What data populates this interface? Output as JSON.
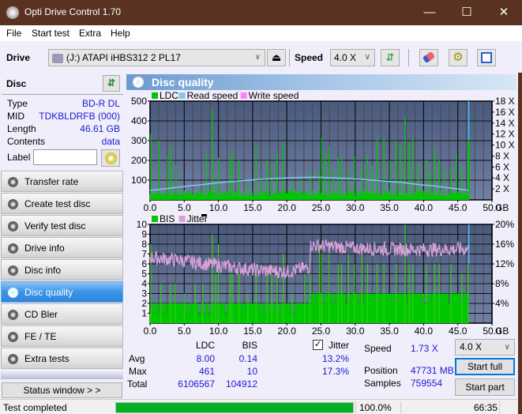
{
  "window": {
    "title": "Opti Drive Control 1.70",
    "minimize": "—",
    "maximize": "☐",
    "close": "✕"
  },
  "menu": [
    "File",
    "Start test",
    "Extra",
    "Help"
  ],
  "toolbar": {
    "drive_label": "Drive",
    "drive_value": "(J:)  ATAPI iHBS312   2 PL17",
    "speed_label": "Speed",
    "speed_value": "4.0 X",
    "icons": [
      "drive-icon",
      "eject-icon",
      "refresh-icon",
      "eraser-icon",
      "settings-icon",
      "save-icon"
    ]
  },
  "disc": {
    "header": "Disc",
    "rows": [
      {
        "key": "Type",
        "value": "BD-R DL"
      },
      {
        "key": "MID",
        "value": "TDKBLDRFB (000)"
      },
      {
        "key": "Length",
        "value": "46.61 GB"
      },
      {
        "key": "Contents",
        "value": "data"
      }
    ],
    "label_key": "Label",
    "label_value": ""
  },
  "nav": [
    {
      "label": "Transfer rate",
      "active": false
    },
    {
      "label": "Create test disc",
      "active": false
    },
    {
      "label": "Verify test disc",
      "active": false
    },
    {
      "label": "Drive info",
      "active": false
    },
    {
      "label": "Disc info",
      "active": false
    },
    {
      "label": "Disc quality",
      "active": true
    },
    {
      "label": "CD Bler",
      "active": false
    },
    {
      "label": "FE / TE",
      "active": false
    },
    {
      "label": "Extra tests",
      "active": false
    }
  ],
  "status_window_label": "Status window > >",
  "panel_title": "Disc quality",
  "colors": {
    "plot_bg_top": "#4a5a7e",
    "plot_bg_bottom": "#7080a4",
    "grid": "#1a1a1a",
    "ldc": "#00c800",
    "read_speed": "#80c8f0",
    "write_speed": "#ff80ff",
    "bis": "#00c800",
    "jitter": "#d8a0d8",
    "end_marker": "#40c0ff"
  },
  "chart_data": [
    {
      "type": "bar",
      "title": "LDC / Read speed",
      "legend": [
        "LDC",
        "Read speed",
        "Write speed"
      ],
      "legend_position": "top-left",
      "xlabel": "GB",
      "x_ticks": [
        "0.0",
        "5.0",
        "10.0",
        "15.0",
        "20.0",
        "25.0",
        "30.0",
        "35.0",
        "40.0",
        "45.0",
        "50.0"
      ],
      "xlim": [
        0,
        50
      ],
      "y_left_ticks": [
        "100",
        "200",
        "300",
        "400",
        "500"
      ],
      "ylim_left": [
        0,
        500
      ],
      "y_right_ticks": [
        "2 X",
        "4 X",
        "6 X",
        "8 X",
        "10 X",
        "12 X",
        "14 X",
        "16 X",
        "18 X"
      ],
      "ylim_right": [
        0,
        18
      ],
      "grid": true,
      "data_end_gb": 46.61,
      "ldc_peaks": [
        [
          0.1,
          335
        ],
        [
          1.3,
          300
        ],
        [
          2.6,
          220
        ],
        [
          3.0,
          270
        ],
        [
          3.8,
          175
        ],
        [
          4.5,
          60
        ],
        [
          5.7,
          50
        ],
        [
          7.4,
          60
        ],
        [
          8.2,
          230
        ],
        [
          9.1,
          461
        ],
        [
          9.6,
          90
        ],
        [
          10.0,
          215
        ],
        [
          11.7,
          210
        ],
        [
          12.0,
          255
        ],
        [
          13.0,
          205
        ],
        [
          14.3,
          95
        ],
        [
          15.5,
          275
        ],
        [
          16.3,
          100
        ],
        [
          17.1,
          200
        ],
        [
          17.8,
          175
        ],
        [
          18.6,
          235
        ],
        [
          19.5,
          295
        ],
        [
          20.8,
          95
        ],
        [
          22.0,
          100
        ],
        [
          23.4,
          140
        ],
        [
          24.8,
          150
        ],
        [
          25.1,
          315
        ],
        [
          25.6,
          230
        ],
        [
          26.2,
          270
        ],
        [
          26.8,
          150
        ],
        [
          27.5,
          210
        ],
        [
          28.0,
          225
        ],
        [
          29.0,
          165
        ],
        [
          29.9,
          220
        ],
        [
          31.0,
          165
        ],
        [
          31.8,
          225
        ],
        [
          32.5,
          175
        ],
        [
          33.2,
          310
        ],
        [
          34.2,
          310
        ],
        [
          35.1,
          200
        ],
        [
          36.0,
          300
        ],
        [
          36.6,
          275
        ],
        [
          37.3,
          420
        ],
        [
          37.9,
          290
        ],
        [
          38.4,
          310
        ],
        [
          39.2,
          190
        ],
        [
          40.4,
          205
        ],
        [
          41.0,
          140
        ],
        [
          41.6,
          260
        ],
        [
          42.3,
          205
        ],
        [
          43.0,
          160
        ],
        [
          44.0,
          165
        ],
        [
          44.8,
          235
        ],
        [
          45.6,
          175
        ],
        [
          46.5,
          290
        ]
      ],
      "read_speed_steps": [
        [
          0,
          1.73
        ],
        [
          1,
          1.85
        ],
        [
          2,
          2.0
        ],
        [
          3,
          2.15
        ],
        [
          4,
          2.3
        ],
        [
          5,
          2.45
        ],
        [
          6,
          2.6
        ],
        [
          7,
          2.7
        ],
        [
          8,
          2.85
        ],
        [
          9,
          3.0
        ],
        [
          10,
          3.15
        ],
        [
          11,
          3.25
        ],
        [
          12,
          3.35
        ],
        [
          13,
          3.45
        ],
        [
          14,
          3.55
        ],
        [
          15,
          3.65
        ],
        [
          16,
          3.75
        ],
        [
          17,
          3.8
        ],
        [
          18,
          3.9
        ],
        [
          19,
          3.95
        ],
        [
          20,
          4.0
        ],
        [
          21,
          4.05
        ],
        [
          22,
          4.1
        ],
        [
          23,
          4.1
        ],
        [
          24,
          4.15
        ],
        [
          25,
          4.1
        ],
        [
          26,
          4.05
        ],
        [
          27,
          4.0
        ],
        [
          28,
          3.95
        ],
        [
          29,
          3.9
        ],
        [
          30,
          3.8
        ],
        [
          31,
          3.75
        ],
        [
          32,
          3.65
        ],
        [
          33,
          3.55
        ],
        [
          34,
          3.45
        ],
        [
          35,
          3.35
        ],
        [
          36,
          3.25
        ],
        [
          37,
          3.15
        ],
        [
          38,
          3.0
        ],
        [
          39,
          2.85
        ],
        [
          40,
          2.7
        ],
        [
          41,
          2.6
        ],
        [
          42,
          2.45
        ],
        [
          43,
          2.3
        ],
        [
          44,
          2.15
        ],
        [
          45,
          2.0
        ],
        [
          46,
          1.85
        ],
        [
          46.61,
          1.73
        ]
      ]
    },
    {
      "type": "bar",
      "title": "BIS / Jitter",
      "legend": [
        "BIS",
        "Jitter"
      ],
      "legend_position": "top-left",
      "xlabel": "GB",
      "x_ticks": [
        "0.0",
        "5.0",
        "10.0",
        "15.0",
        "20.0",
        "25.0",
        "30.0",
        "35.0",
        "40.0",
        "45.0",
        "50.0"
      ],
      "xlim": [
        0,
        50
      ],
      "y_left_ticks": [
        "1",
        "2",
        "3",
        "4",
        "5",
        "6",
        "7",
        "8",
        "9",
        "10"
      ],
      "ylim_left": [
        0,
        10
      ],
      "y_right_ticks": [
        "4%",
        "8%",
        "12%",
        "16%",
        "20%"
      ],
      "ylim_right": [
        0,
        20
      ],
      "grid": true,
      "data_end_gb": 46.61,
      "bis_base_levels": [
        [
          0,
          23.3,
          2
        ],
        [
          23.3,
          46.61,
          3
        ]
      ],
      "bis_peaks": [
        [
          0.1,
          8
        ],
        [
          1.6,
          4
        ],
        [
          3.0,
          4
        ],
        [
          3.7,
          4
        ],
        [
          5.0,
          3
        ],
        [
          6.6,
          4
        ],
        [
          7.7,
          4
        ],
        [
          9.1,
          9
        ],
        [
          9.6,
          5
        ],
        [
          10.0,
          8
        ],
        [
          11.7,
          5
        ],
        [
          12.0,
          5
        ],
        [
          13.0,
          5
        ],
        [
          14.3,
          3
        ],
        [
          15.5,
          5
        ],
        [
          17.1,
          5
        ],
        [
          17.8,
          5
        ],
        [
          18.6,
          5
        ],
        [
          19.5,
          7
        ],
        [
          20.8,
          3
        ],
        [
          22.6,
          5
        ],
        [
          23.4,
          5
        ],
        [
          24.8,
          8
        ],
        [
          25.1,
          7
        ],
        [
          26.2,
          7
        ],
        [
          27.5,
          6
        ],
        [
          28.0,
          6
        ],
        [
          29.0,
          7
        ],
        [
          29.9,
          6
        ],
        [
          31.0,
          7
        ],
        [
          31.8,
          6
        ],
        [
          33.2,
          6
        ],
        [
          34.2,
          6
        ],
        [
          36.0,
          6
        ],
        [
          37.3,
          10
        ],
        [
          37.9,
          6
        ],
        [
          38.4,
          6
        ],
        [
          40.4,
          6
        ],
        [
          41.6,
          6
        ],
        [
          42.3,
          6
        ],
        [
          44.0,
          6
        ],
        [
          45.6,
          5
        ],
        [
          46.5,
          6
        ]
      ],
      "jitter_segments": [
        [
          0,
          13.3
        ],
        [
          5,
          12.6
        ],
        [
          10,
          11.7
        ],
        [
          15,
          10.8
        ],
        [
          20,
          10.4
        ],
        [
          23.3,
          11.3
        ],
        [
          23.5,
          15.8
        ],
        [
          30,
          15.2
        ],
        [
          35,
          15.0
        ],
        [
          40,
          14.9
        ],
        [
          46.61,
          15.0
        ]
      ]
    }
  ],
  "stats": {
    "col_ldc": "LDC",
    "col_bis": "BIS",
    "jitter_label": "Jitter",
    "jitter_checked": true,
    "rows": [
      {
        "label": "Avg",
        "ldc": "8.00",
        "bis": "0.14",
        "jitter": "13.2%"
      },
      {
        "label": "Max",
        "ldc": "461",
        "bis": "10",
        "jitter": "17.3%"
      },
      {
        "label": "Total",
        "ldc": "6106567",
        "bis": "104912",
        "jitter": ""
      }
    ],
    "speed_label": "Speed",
    "speed_value": "1.73 X",
    "position_label": "Position",
    "position_value": "47731 MB",
    "samples_label": "Samples",
    "samples_value": "759554",
    "speed_select": "4.0 X",
    "start_full": "Start full",
    "start_part": "Start part"
  },
  "statusbar": {
    "text": "Test completed",
    "progress_percent": 100,
    "progress_label": "100.0%",
    "time": "66:35"
  }
}
